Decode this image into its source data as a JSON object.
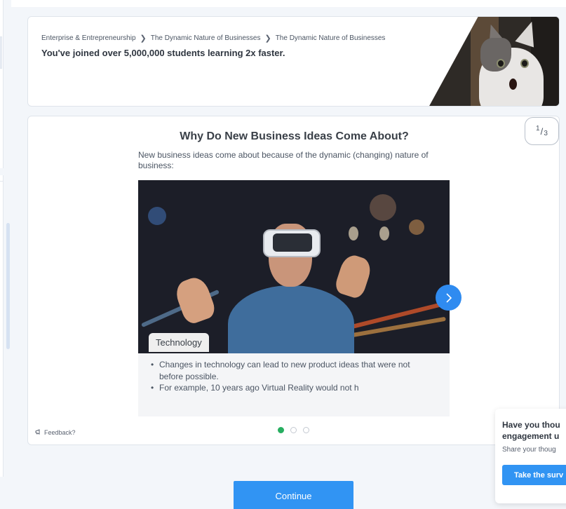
{
  "breadcrumb": {
    "items": [
      "Enterprise & Entrepreneurship",
      "The Dynamic Nature of Businesses",
      "The Dynamic Nature of Businesses"
    ]
  },
  "header": {
    "joined_text": "You've joined over 5,000,000 students learning 2x faster."
  },
  "lesson": {
    "page_current": "1",
    "page_total": "3",
    "title": "Why Do New Business Ideas Come About?",
    "intro": "New business ideas come about because of the dynamic (changing) nature of business:",
    "slide_caption": "Technology",
    "bullets": [
      "Changes in technology can lead to new product ideas that were not before possible.",
      "For example, 10 years ago Virtual Reality would not h"
    ],
    "slides_total": 3,
    "active_slide": 1
  },
  "feedback": {
    "label": "Feedback?"
  },
  "continue_label": "Continue",
  "survey": {
    "question": "Have you thou engagement u",
    "question_line1": "Have you thou",
    "question_line2": "engagement u",
    "subtext": "Share your thoug",
    "button_label": "Take the surv"
  },
  "colors": {
    "accent": "#3194f3",
    "active_dot": "#27ae60",
    "background": "#f3f6fa"
  }
}
